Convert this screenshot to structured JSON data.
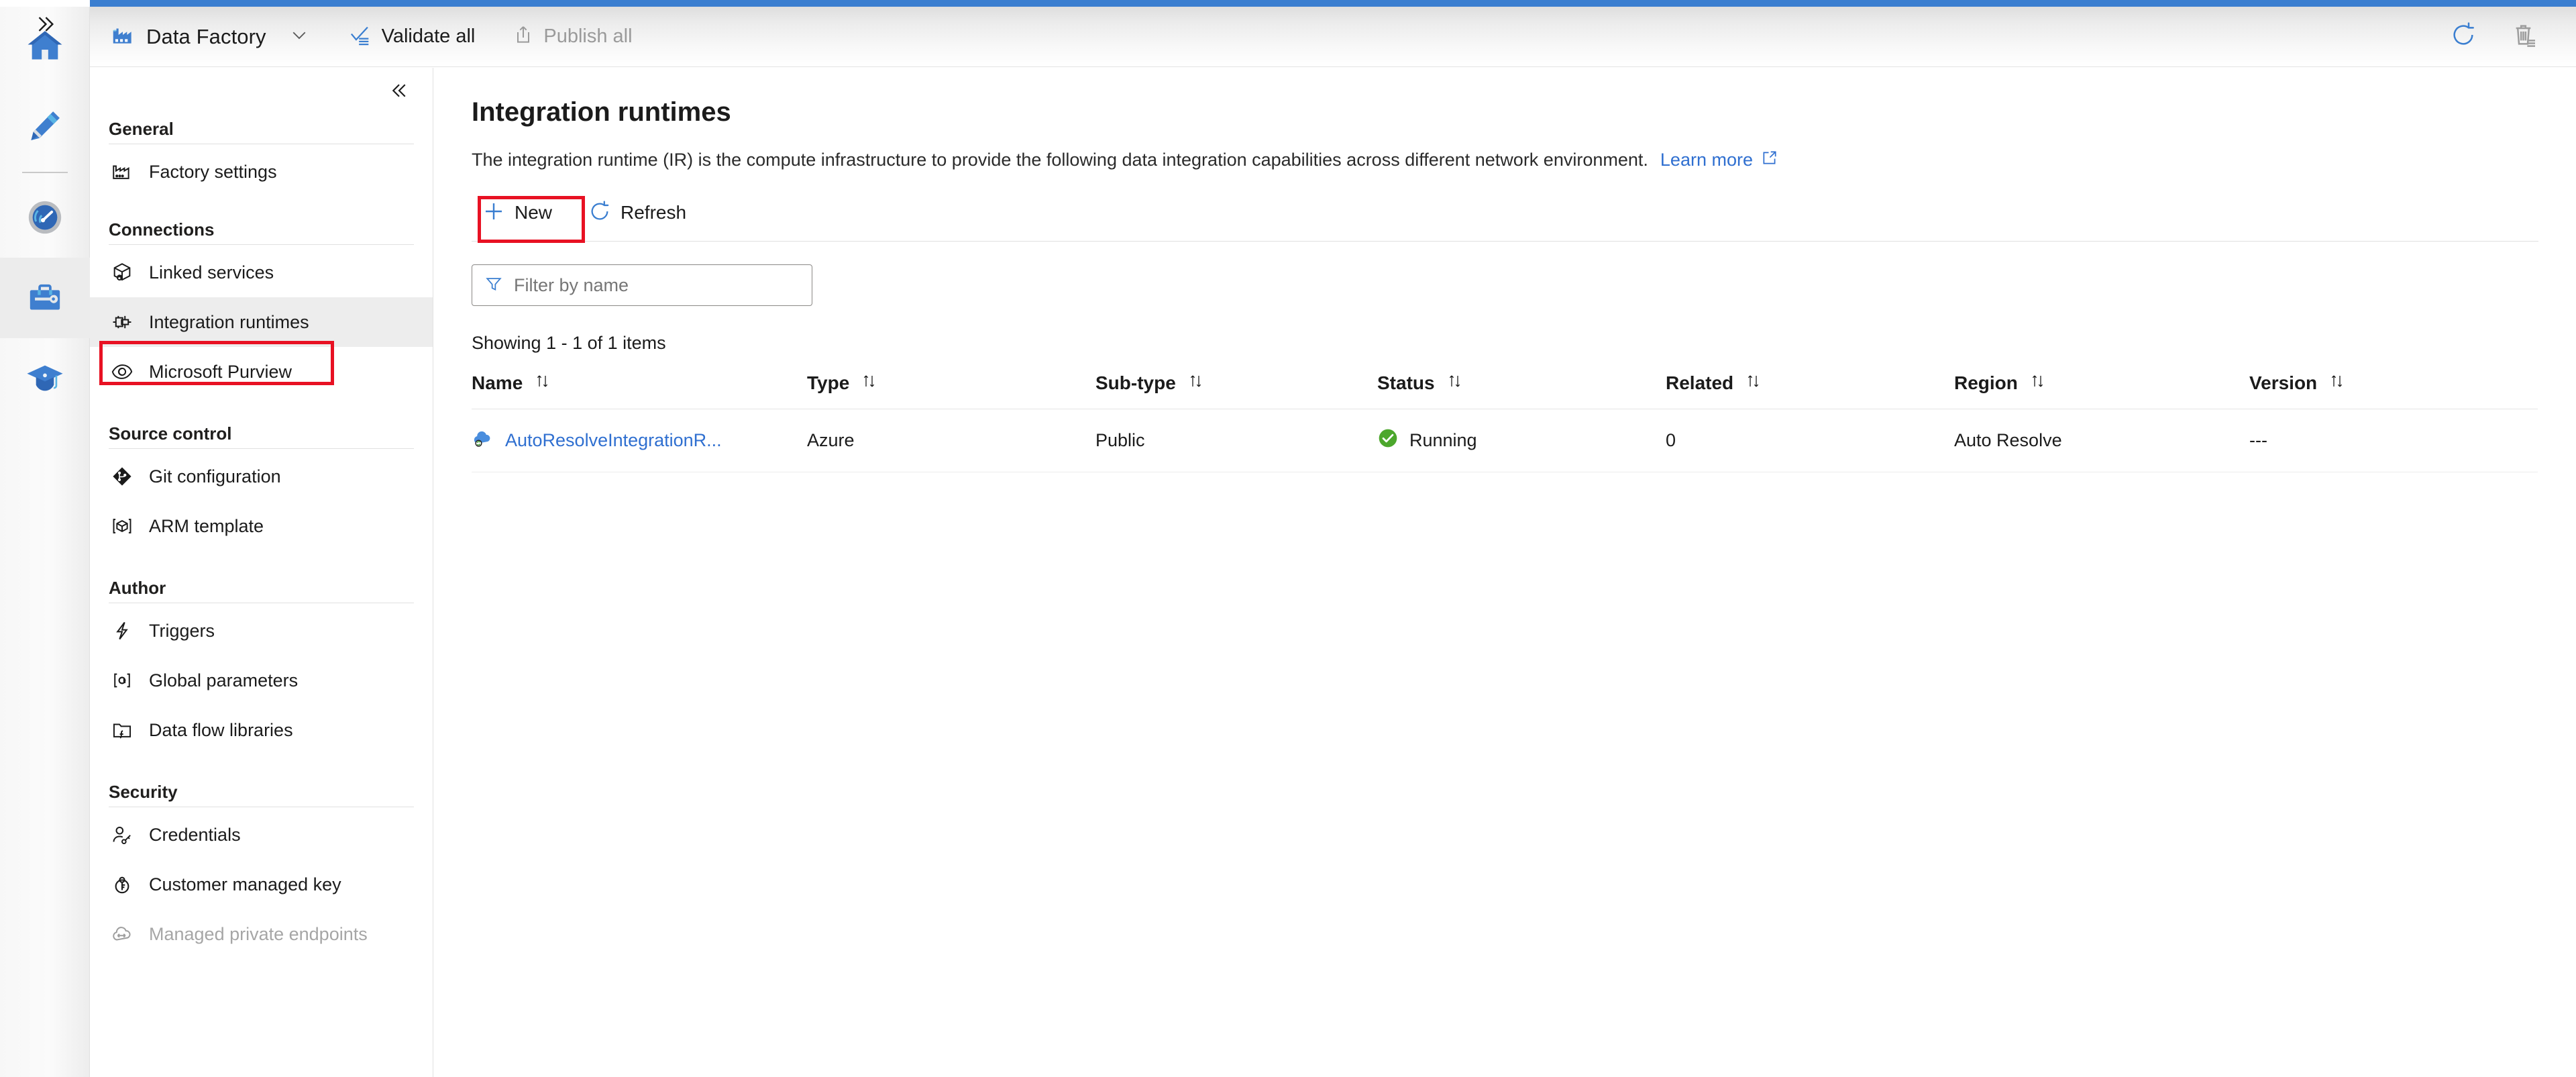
{
  "accent_color": "#3a7ed0",
  "link_color": "#2f6fd0",
  "annotation_color": "#e81123",
  "status_color": "#4ca72c",
  "header": {
    "collapse_rail_icon": "chevron-double-right-icon",
    "app_icon": "data-factory-icon",
    "app_title": "Data Factory",
    "app_chevron_icon": "chevron-down-icon",
    "validate_all": {
      "label": "Validate all",
      "icon": "validate-icon"
    },
    "publish_all": {
      "label": "Publish all",
      "icon": "publish-upload-icon"
    },
    "refresh_icon": "refresh-circle-icon",
    "delete_icon": "trash-icon"
  },
  "rail": {
    "items": [
      {
        "name": "home",
        "icon": "home-icon"
      },
      {
        "name": "author",
        "icon": "pencil-icon"
      },
      {
        "name": "monitor",
        "icon": "gauge-monitor-icon"
      },
      {
        "name": "manage",
        "icon": "toolbox-wrench-icon",
        "selected": true
      },
      {
        "name": "learning-center",
        "icon": "graduation-cap-icon"
      }
    ]
  },
  "sidebar": {
    "collapse_icon": "chevron-double-left-icon",
    "groups": [
      {
        "title": "General",
        "items": [
          {
            "label": "Factory settings",
            "icon": "factory-icon",
            "active": false,
            "disabled": false
          }
        ]
      },
      {
        "title": "Connections",
        "items": [
          {
            "label": "Linked services",
            "icon": "linked-services-icon",
            "active": false,
            "disabled": false
          },
          {
            "label": "Integration runtimes",
            "icon": "integration-runtime-icon",
            "active": true,
            "disabled": false
          },
          {
            "label": "Microsoft Purview",
            "icon": "purview-eye-icon",
            "active": false,
            "disabled": false
          }
        ]
      },
      {
        "title": "Source control",
        "items": [
          {
            "label": "Git configuration",
            "icon": "git-icon",
            "active": false,
            "disabled": false
          },
          {
            "label": "ARM template",
            "icon": "arm-template-icon",
            "active": false,
            "disabled": false
          }
        ]
      },
      {
        "title": "Author",
        "items": [
          {
            "label": "Triggers",
            "icon": "lightning-icon",
            "active": false,
            "disabled": false
          },
          {
            "label": "Global parameters",
            "icon": "global-parameters-icon",
            "active": false,
            "disabled": false
          },
          {
            "label": "Data flow libraries",
            "icon": "data-flow-libraries-icon",
            "active": false,
            "disabled": false
          }
        ]
      },
      {
        "title": "Security",
        "items": [
          {
            "label": "Credentials",
            "icon": "credentials-key-icon",
            "active": false,
            "disabled": false
          },
          {
            "label": "Customer managed key",
            "icon": "key-circle-icon",
            "active": false,
            "disabled": false
          },
          {
            "label": "Managed private endpoints",
            "icon": "managed-private-endpoint-icon",
            "active": false,
            "disabled": true
          }
        ]
      }
    ]
  },
  "main": {
    "title": "Integration runtimes",
    "description": "The integration runtime (IR) is the compute infrastructure to provide the following data integration capabilities across different network environment.",
    "learn_more": {
      "label": "Learn more",
      "icon": "external-link-icon"
    },
    "commands": {
      "new": {
        "label": "New",
        "icon": "plus-icon"
      },
      "refresh": {
        "label": "Refresh",
        "icon": "refresh-circle-icon"
      }
    },
    "filter": {
      "placeholder": "Filter by name",
      "value": "",
      "icon": "funnel-filter-icon"
    },
    "showing": "Showing 1 - 1 of 1 items",
    "sort_icon": "sort-updown-icon",
    "table": {
      "columns": [
        "Name",
        "Type",
        "Sub-type",
        "Status",
        "Related",
        "Region",
        "Version"
      ],
      "rows": [
        {
          "icon": "azure-ir-cloud-icon",
          "name": "AutoResolveIntegrationR...",
          "type": "Azure",
          "subtype": "Public",
          "status": "Running",
          "status_icon": "check-circle-icon",
          "related": "0",
          "region": "Auto Resolve",
          "version": "---"
        }
      ]
    }
  }
}
